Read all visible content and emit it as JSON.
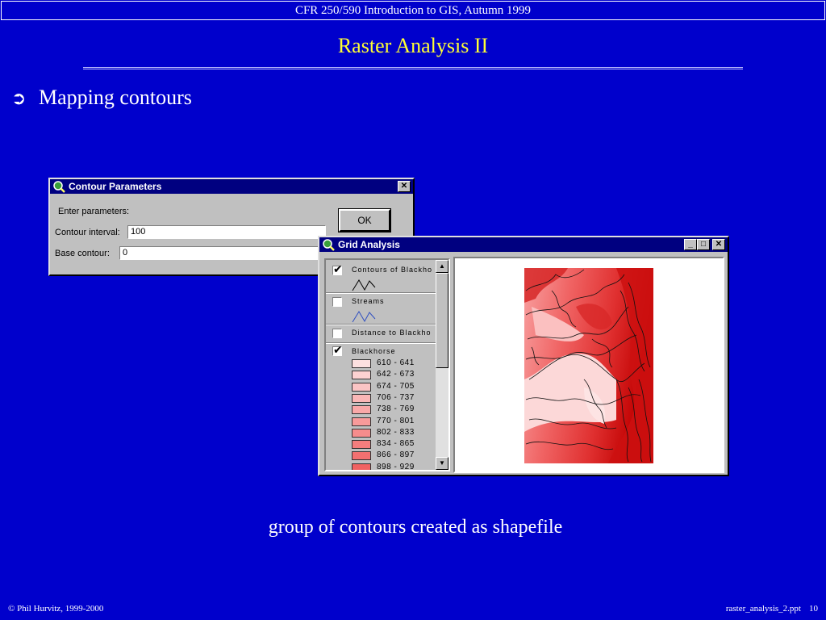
{
  "slide": {
    "header": "CFR 250/590 Introduction to GIS, Autumn 1999",
    "title": "Raster Analysis II",
    "bullet": "Mapping contours",
    "caption": "group of contours created as shapefile",
    "footer_left": "© Phil Hurvitz, 1999-2000",
    "footer_file": "raster_analysis_2.ppt",
    "footer_page": "10"
  },
  "contour_dialog": {
    "title": "Contour Parameters",
    "prompt": "Enter parameters:",
    "interval_label": "Contour interval:",
    "interval_value": "100",
    "base_label": "Base contour:",
    "base_value": "0",
    "ok_label": "OK"
  },
  "grid_window": {
    "title": "Grid Analysis",
    "layers": [
      {
        "name": "Contours of Blackho",
        "checked": true
      },
      {
        "name": "Streams",
        "checked": false
      },
      {
        "name": "Distance to Blackho",
        "checked": false
      },
      {
        "name": "Blackhorse",
        "checked": true
      }
    ],
    "legend": [
      {
        "range": "610 - 641",
        "color": "#fde0e0"
      },
      {
        "range": "642 - 673",
        "color": "#fcd2d2"
      },
      {
        "range": "674 - 705",
        "color": "#fbc4c4"
      },
      {
        "range": "706 - 737",
        "color": "#fab6b6"
      },
      {
        "range": "738 - 769",
        "color": "#f9a8a8"
      },
      {
        "range": "770 - 801",
        "color": "#f89a9a"
      },
      {
        "range": "802 - 833",
        "color": "#f68c8c"
      },
      {
        "range": "834 - 865",
        "color": "#f47e7e"
      },
      {
        "range": "866 - 897",
        "color": "#f27070"
      },
      {
        "range": "898 - 929",
        "color": "#f06262"
      }
    ]
  },
  "colors": {
    "slide_background": "#0000cc",
    "title_color": "#ffff33",
    "titlebar": "#000080",
    "contour_line": "#203080",
    "stream_line": "#3050c0"
  },
  "icons": {
    "bullet": "arrow-circle-icon",
    "app": "magnifier-globe-icon"
  }
}
